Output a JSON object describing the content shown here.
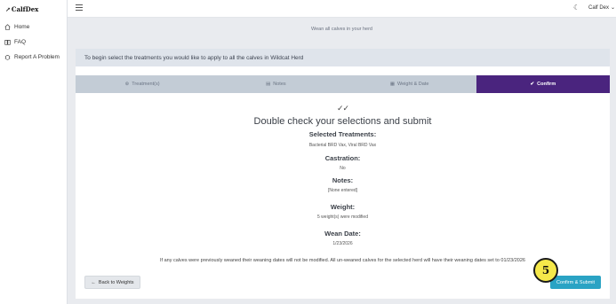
{
  "app": {
    "logo_text": "CalfDex",
    "logo_mark": "↗"
  },
  "sidebar": {
    "items": [
      {
        "label": "Home",
        "icon": "home-icon"
      },
      {
        "label": "FAQ",
        "icon": "book-icon"
      },
      {
        "label": "Report A Problem",
        "icon": "bug-icon"
      }
    ]
  },
  "topbar": {
    "user_label": "Calf Dex",
    "theme_icon": "moon-icon"
  },
  "page": {
    "subtitle": "Wean all calves in your herd",
    "banner": "To begin select the treatments you would like to apply to all the calves in Wildcat Herd"
  },
  "steps": [
    {
      "label": "Treatment(s)",
      "icon": "⊛",
      "active": false
    },
    {
      "label": "Notes",
      "icon": "▤",
      "active": false
    },
    {
      "label": "Weight & Date",
      "icon": "▦",
      "active": false
    },
    {
      "label": "Confirm",
      "icon": "✔",
      "active": true
    }
  ],
  "confirm": {
    "mark": "✓✓",
    "heading": "Double check your selections and submit",
    "treatments_title": "Selected Treatments:",
    "treatments_value": "Bacterial BRD Vax, Viral BRD Vax",
    "castration_title": "Castration:",
    "castration_value": "No",
    "notes_title": "Notes:",
    "notes_value": "[None entered]",
    "weight_title": "Weight:",
    "weight_value": "5 weight(s) were modified",
    "wean_title": "Wean Date:",
    "wean_value": "1/23/2026"
  },
  "notice": "If any calves were previously weaned their weaning dates will not be modified. All un-weaned calves for the selected herd will have their weaning dates set to 01/23/2026",
  "buttons": {
    "back": "Back to Weights",
    "submit": "Confirm & Submit"
  },
  "marker": {
    "number": "5"
  },
  "colors": {
    "accent": "#4a247e",
    "submit": "#2aa3c4",
    "step_inactive": "#c3ccd6"
  }
}
